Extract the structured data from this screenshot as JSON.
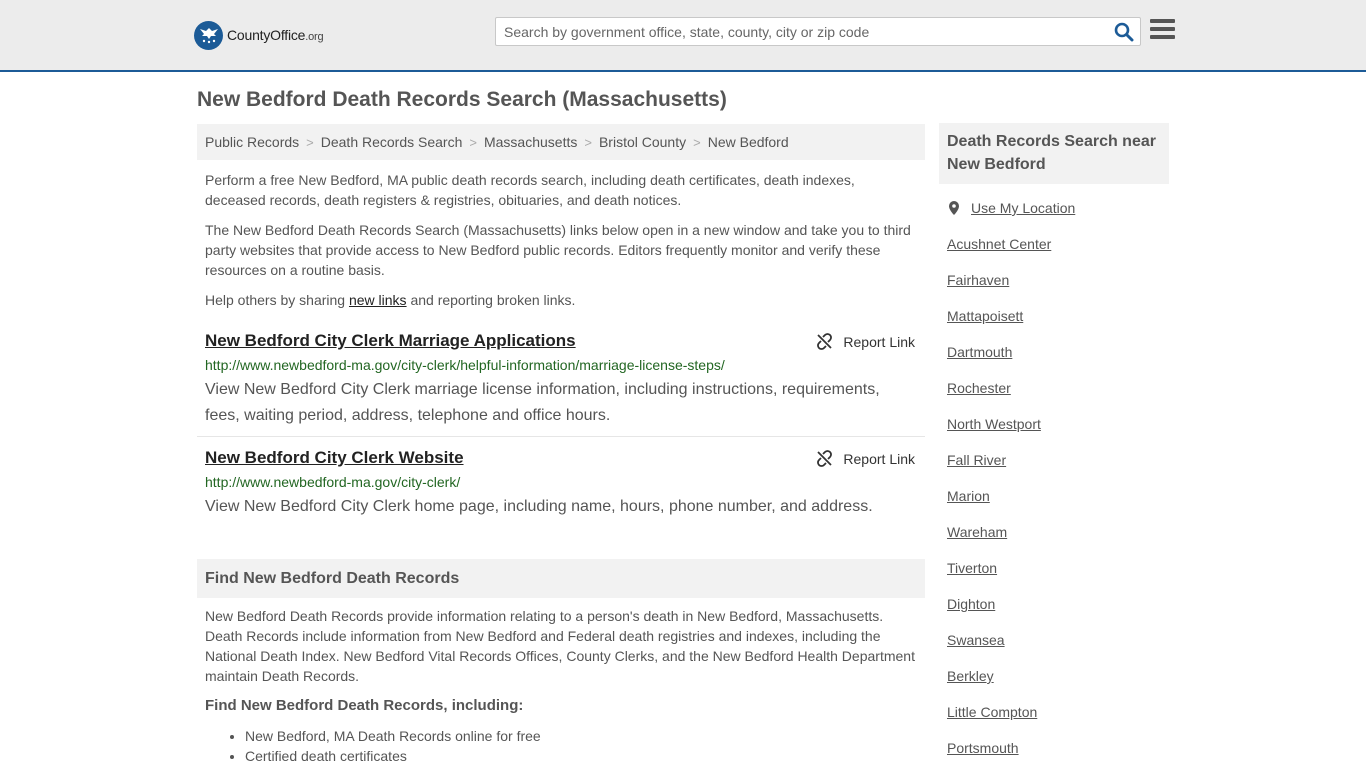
{
  "header": {
    "logo_name": "CountyOffice",
    "logo_tld": ".org",
    "search_placeholder": "Search by government office, state, county, city or zip code"
  },
  "page": {
    "title": "New Bedford Death Records Search (Massachusetts)"
  },
  "breadcrumb": [
    "Public Records",
    "Death Records Search",
    "Massachusetts",
    "Bristol County",
    "New Bedford"
  ],
  "intro": {
    "p1": "Perform a free New Bedford, MA public death records search, including death certificates, death indexes, deceased records, death registers & registries, obituaries, and death notices.",
    "p2": "The New Bedford Death Records Search (Massachusetts) links below open in a new window and take you to third party websites that provide access to New Bedford public records. Editors frequently monitor and verify these resources on a routine basis.",
    "p3_before": "Help others by sharing ",
    "p3_link": "new links",
    "p3_after": " and reporting broken links."
  },
  "links": [
    {
      "title": "New Bedford City Clerk Marriage Applications",
      "url": "http://www.newbedford-ma.gov/city-clerk/helpful-information/marriage-license-steps/",
      "desc": "View New Bedford City Clerk marriage license information, including instructions, requirements, fees, waiting period, address, telephone and office hours.",
      "report": "Report Link"
    },
    {
      "title": "New Bedford City Clerk Website",
      "url": "http://www.newbedford-ma.gov/city-clerk/",
      "desc": "View New Bedford City Clerk home page, including name, hours, phone number, and address.",
      "report": "Report Link"
    }
  ],
  "find": {
    "heading": "Find New Bedford Death Records",
    "body": "New Bedford Death Records provide information relating to a person's death in New Bedford, Massachusetts. Death Records include information from New Bedford and Federal death registries and indexes, including the National Death Index. New Bedford Vital Records Offices, County Clerks, and the New Bedford Health Department maintain Death Records.",
    "subheading": "Find New Bedford Death Records, including:",
    "bullets": [
      "New Bedford, MA Death Records online for free",
      "Certified death certificates"
    ]
  },
  "sidebar": {
    "heading": "Death Records Search near New Bedford",
    "use_location": "Use My Location",
    "places": [
      "Acushnet Center",
      "Fairhaven",
      "Mattapoisett",
      "Dartmouth",
      "Rochester",
      "North Westport",
      "Fall River",
      "Marion",
      "Wareham",
      "Tiverton",
      "Dighton",
      "Swansea",
      "Berkley",
      "Little Compton",
      "Portsmouth"
    ]
  }
}
